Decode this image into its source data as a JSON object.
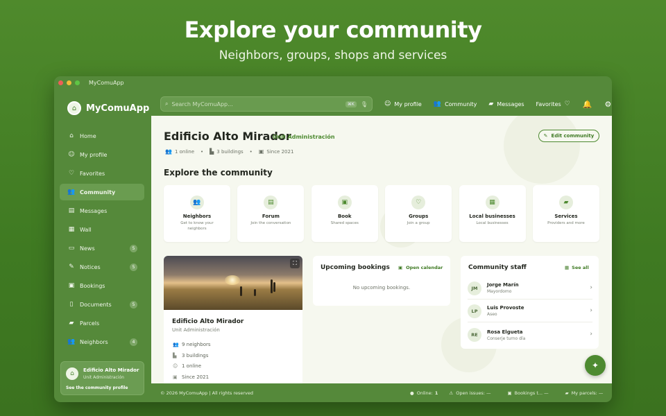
{
  "hero": {
    "title": "Explore your community",
    "subtitle": "Neighbors, groups, shops and services"
  },
  "window": {
    "title": "MyComuApp"
  },
  "brand": {
    "name": "MyComuApp"
  },
  "topbar": {
    "search_placeholder": "Search MyComuApp...",
    "shortcut": "⌘K",
    "links": {
      "profile": "My profile",
      "community": "Community",
      "messages": "Messages",
      "favorites": "Favorites"
    }
  },
  "sidebar": {
    "items": [
      {
        "label": "Home",
        "icon": "home-icon",
        "badge": ""
      },
      {
        "label": "My profile",
        "icon": "user-icon",
        "badge": ""
      },
      {
        "label": "Favorites",
        "icon": "heart-icon",
        "badge": ""
      },
      {
        "label": "Community",
        "icon": "users-icon",
        "badge": ""
      },
      {
        "label": "Messages",
        "icon": "chat-icon",
        "badge": ""
      },
      {
        "label": "Wall",
        "icon": "wall-icon",
        "badge": ""
      },
      {
        "label": "News",
        "icon": "news-icon",
        "badge": "5"
      },
      {
        "label": "Notices",
        "icon": "megaphone-icon",
        "badge": "5"
      },
      {
        "label": "Bookings",
        "icon": "calendar-icon",
        "badge": ""
      },
      {
        "label": "Documents",
        "icon": "document-icon",
        "badge": "5"
      },
      {
        "label": "Parcels",
        "icon": "truck-icon",
        "badge": ""
      },
      {
        "label": "Neighbors",
        "icon": "people-icon",
        "badge": "4"
      }
    ],
    "profile_card": {
      "name": "Edificio Alto Mirador",
      "role": "Unit Administración",
      "link": "See the community profile"
    }
  },
  "main": {
    "title": "Edificio Alto Mirador",
    "unit_tag": "Unit Administración",
    "meta": {
      "online": "1 online",
      "buildings": "3 buildings",
      "since": "Since 2021"
    },
    "edit_button": "Edit community",
    "explore_title": "Explore the community",
    "cards": [
      {
        "title": "Neighbors",
        "sub": "Get to know your neighbors",
        "icon": "neighbors-icon"
      },
      {
        "title": "Forum",
        "sub": "Join the conversation",
        "icon": "forum-icon"
      },
      {
        "title": "Book",
        "sub": "Shared spaces",
        "icon": "book-icon"
      },
      {
        "title": "Groups",
        "sub": "Join a group",
        "icon": "groups-icon"
      },
      {
        "title": "Local businesses",
        "sub": "Local businesses",
        "icon": "store-icon"
      },
      {
        "title": "Services",
        "sub": "Providers and more",
        "icon": "car-icon"
      }
    ],
    "community_card": {
      "title": "Edificio Alto Mirador",
      "sub": "Unit Administración",
      "rows": [
        "9 neighbors",
        "3 buildings",
        "1 online",
        "Since 2021"
      ]
    },
    "bookings": {
      "title": "Upcoming bookings",
      "link": "Open calendar",
      "empty": "No upcoming bookings."
    },
    "staff": {
      "title": "Community staff",
      "link": "See all",
      "members": [
        {
          "initials": "JM",
          "name": "Jorge Marín",
          "role": "Mayordomo"
        },
        {
          "initials": "LP",
          "name": "Luis Provoste",
          "role": "Aseo"
        },
        {
          "initials": "RE",
          "name": "Rosa Elgueta",
          "role": "Conserje turno día"
        }
      ]
    }
  },
  "footer": {
    "copyright": "© 2026 MyComuApp | All rights reserved",
    "online_label": "Online:",
    "online_value": "1",
    "open_issues": "Open issues: —",
    "bookings": "Bookings t... —",
    "parcels": "My parcels: —"
  },
  "colors": {
    "brand": "#4d8a30",
    "sidebar": "#55893a",
    "content": "#f6f8ef"
  }
}
